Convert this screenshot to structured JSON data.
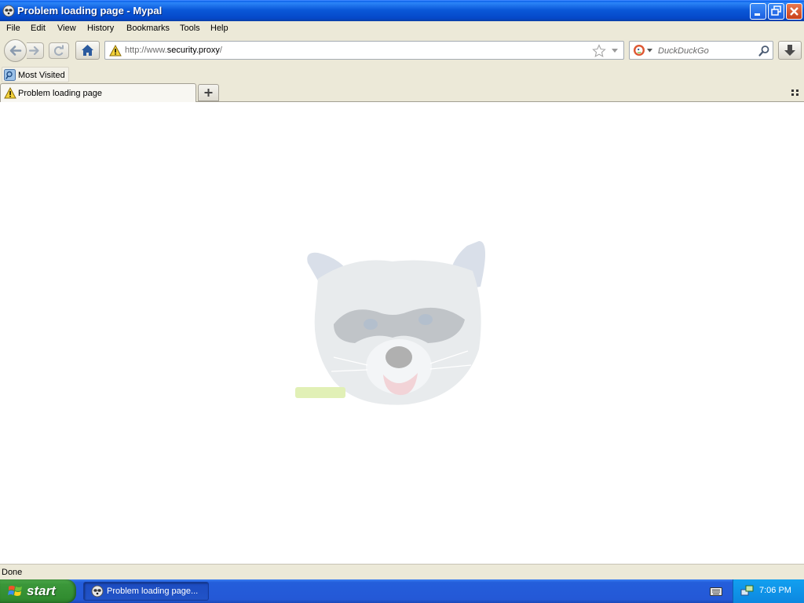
{
  "window": {
    "title": "Problem loading page - Mypal"
  },
  "menu": {
    "items": [
      "File",
      "Edit",
      "View",
      "History",
      "Bookmarks",
      "Tools",
      "Help"
    ]
  },
  "navbar": {
    "url": {
      "prefix": "http://www.",
      "host": "security.proxy",
      "suffix": "/"
    },
    "search": {
      "engine": "DuckDuckGo",
      "placeholder": "DuckDuckGo"
    }
  },
  "bookmarks": {
    "items": [
      "Most Visited"
    ]
  },
  "tabs": [
    {
      "label": "Problem loading page",
      "active": true,
      "icon": "warning-icon"
    }
  ],
  "content": {
    "image": "raccoon-mascot-icon"
  },
  "status": {
    "text": "Done"
  },
  "taskbar": {
    "start_label": "start",
    "task_label": "Problem loading page...",
    "clock": "7:06 PM"
  },
  "colors": {
    "titlebar": "#0a58d8",
    "chrome": "#ece9d8",
    "taskbar": "#245edb",
    "start": "#3b973a",
    "tray": "#0c87e0"
  }
}
